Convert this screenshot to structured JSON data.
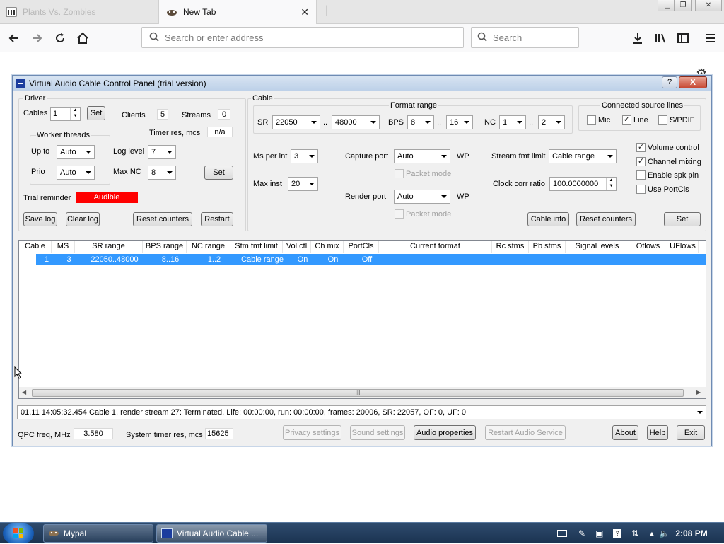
{
  "browser": {
    "tabs": [
      {
        "title": "Plants Vs. Zombies",
        "active": false
      },
      {
        "title": "New Tab",
        "active": true
      }
    ],
    "url_placeholder": "Search or enter address",
    "search_placeholder": "Search"
  },
  "dialog": {
    "title": "Virtual Audio Cable Control Panel (trial version)",
    "help": "?",
    "close": "X",
    "driver": {
      "group_label": "Driver",
      "cables_label": "Cables",
      "cables_value": "1",
      "set_label": "Set",
      "clients_label": "Clients",
      "clients_value": "5",
      "streams_label": "Streams",
      "streams_value": "0",
      "worker_threads_label": "Worker threads",
      "timer_res_label": "Timer res, mcs",
      "timer_res_value": "n/a",
      "upto_label": "Up to",
      "upto_value": "Auto",
      "prio_label": "Prio",
      "prio_value": "Auto",
      "log_level_label": "Log level",
      "log_level_value": "7",
      "max_nc_label": "Max NC",
      "max_nc_value": "8",
      "set2_label": "Set",
      "trial_reminder_label": "Trial reminder",
      "trial_reminder_value": "Audible",
      "save_log": "Save log",
      "clear_log": "Clear log",
      "reset_counters": "Reset counters",
      "restart": "Restart"
    },
    "cable": {
      "group_label": "Cable",
      "format_range_label": "Format range",
      "sr_label": "SR",
      "sr_min": "22050",
      "sr_max": "48000",
      "range_sep": "..",
      "bps_label": "BPS",
      "bps_min": "8",
      "bps_max": "16",
      "nc_label": "NC",
      "nc_min": "1",
      "nc_max": "2",
      "connected_lines_label": "Connected source lines",
      "mic_label": "Mic",
      "line_label": "Line",
      "spdif_label": "S/PDIF",
      "ms_per_int_label": "Ms per int",
      "ms_per_int_value": "3",
      "max_inst_label": "Max inst",
      "max_inst_value": "20",
      "capture_port_label": "Capture port",
      "capture_port_value": "Auto",
      "wp_label": "WP",
      "packet_mode_label": "Packet mode",
      "render_port_label": "Render port",
      "render_port_value": "Auto",
      "stream_fmt_limit_label": "Stream fmt limit",
      "stream_fmt_limit_value": "Cable range",
      "clock_corr_label": "Clock corr ratio",
      "clock_corr_value": "100.0000000",
      "volume_control": "Volume control",
      "channel_mixing": "Channel mixing",
      "enable_spk_pin": "Enable spk pin",
      "use_portcls": "Use PortCls",
      "cable_info": "Cable info",
      "reset_counters": "Reset counters",
      "set_label": "Set"
    },
    "table": {
      "headers": [
        "Cable",
        "MS",
        "SR range",
        "BPS range",
        "NC range",
        "Stm fmt limit",
        "Vol ctl",
        "Ch mix",
        "PortCls",
        "Current format",
        "Rc stms",
        "Pb stms",
        "Signal levels",
        "Oflows",
        "UFlows"
      ],
      "rows": [
        [
          "1",
          "3",
          "22050..48000",
          "8..16",
          "1..2",
          "Cable range",
          "On",
          "On",
          "Off",
          "",
          "",
          "",
          "",
          "",
          ""
        ]
      ],
      "scroll_grip": "III"
    },
    "log_line": "01.11   14:05:32.454   Cable 1, render stream 27: Terminated. Life: 00:00:00, run: 00:00:00, frames: 20006, SR: 22057, OF: 0, UF: 0",
    "footer": {
      "qpc_label": "QPC freq, MHz",
      "qpc_value": "3.580",
      "sys_timer_label": "System timer res, mcs",
      "sys_timer_value": "15625",
      "privacy_settings": "Privacy settings",
      "sound_settings": "Sound settings",
      "audio_properties": "Audio properties",
      "restart_audio": "Restart Audio Service",
      "about": "About",
      "help": "Help",
      "exit": "Exit"
    }
  },
  "taskbar": {
    "items": [
      {
        "label": "Mypal"
      },
      {
        "label": "Virtual Audio Cable ..."
      }
    ],
    "clock": "2:08 PM"
  }
}
